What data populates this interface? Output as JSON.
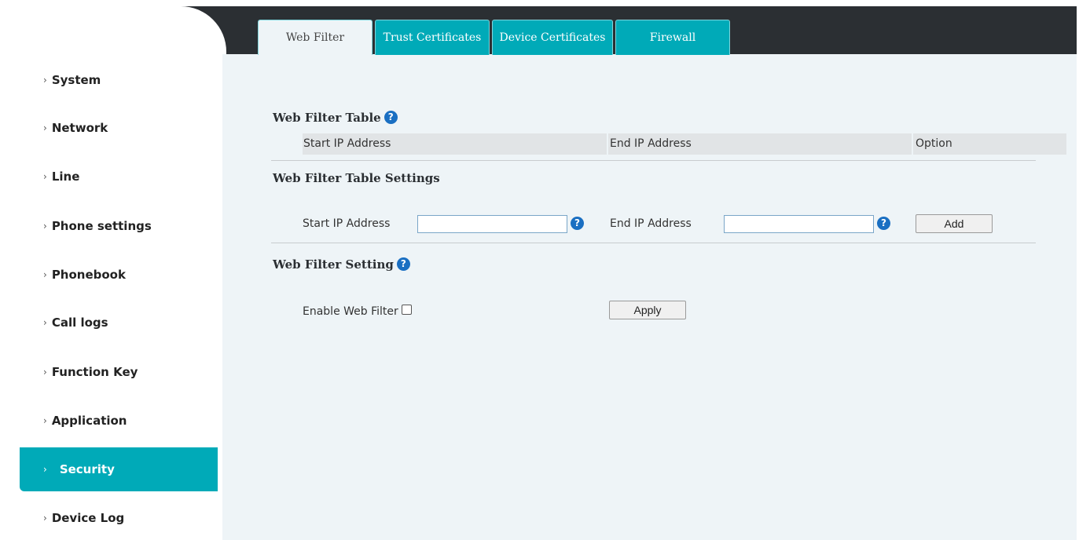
{
  "sidebar": {
    "items": [
      {
        "label": "System"
      },
      {
        "label": "Network"
      },
      {
        "label": "Line"
      },
      {
        "label": "Phone settings"
      },
      {
        "label": "Phonebook"
      },
      {
        "label": "Call logs"
      },
      {
        "label": "Function Key"
      },
      {
        "label": "Application"
      },
      {
        "label": "Security",
        "active": true
      },
      {
        "label": "Device Log"
      }
    ],
    "chevron": "›"
  },
  "tabs": [
    {
      "label": "Web Filter",
      "active": true
    },
    {
      "label": "Trust Certificates"
    },
    {
      "label": "Device Certificates"
    },
    {
      "label": "Firewall"
    }
  ],
  "web_filter_table": {
    "title": "Web Filter Table",
    "columns": [
      "Start IP Address",
      "End IP Address",
      "Option"
    ]
  },
  "table_settings": {
    "title": "Web Filter Table Settings",
    "start_label": "Start IP Address",
    "start_value": "",
    "end_label": "End IP Address",
    "end_value": "",
    "add_label": "Add"
  },
  "web_filter_setting": {
    "title": "Web Filter Setting",
    "enable_label": "Enable Web Filter",
    "enable_checked": false,
    "apply_label": "Apply"
  },
  "help_glyph": "?",
  "colors": {
    "accent": "#00aab8",
    "topbar": "#2b2f33",
    "panel": "#eef4f7",
    "help": "#1a6fc2"
  }
}
